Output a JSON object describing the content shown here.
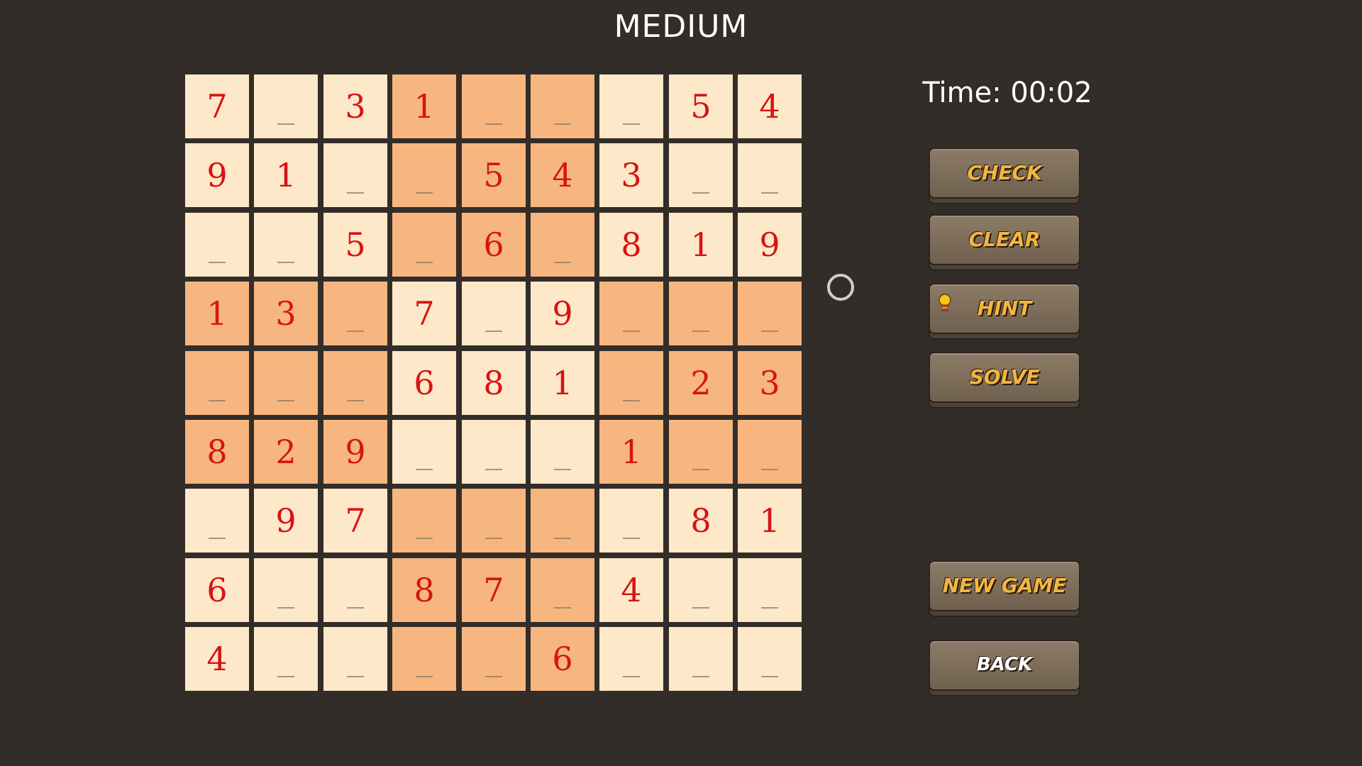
{
  "header": {
    "difficulty": "MEDIUM"
  },
  "timer": {
    "text": "Time: 00:02"
  },
  "board": {
    "rows": [
      [
        "7",
        "",
        "3",
        "1",
        "",
        "",
        "",
        "5",
        "4"
      ],
      [
        "9",
        "1",
        "",
        "",
        "5",
        "4",
        "3",
        "",
        ""
      ],
      [
        "",
        "",
        "5",
        "",
        "6",
        "",
        "8",
        "1",
        "9"
      ],
      [
        "1",
        "3",
        "",
        "7",
        "",
        "9",
        "",
        "",
        ""
      ],
      [
        "",
        "",
        "",
        "6",
        "8",
        "1",
        "",
        "2",
        "3"
      ],
      [
        "8",
        "2",
        "9",
        "",
        "",
        "",
        "1",
        "",
        ""
      ],
      [
        "",
        "9",
        "7",
        "",
        "",
        "",
        "",
        "8",
        "1"
      ],
      [
        "6",
        "",
        "",
        "8",
        "7",
        "",
        "4",
        "",
        ""
      ],
      [
        "4",
        "",
        "",
        "",
        "",
        "6",
        "",
        "",
        ""
      ]
    ]
  },
  "buttons": {
    "check": "CHECK",
    "clear": "CLEAR",
    "hint": "HINT",
    "solve": "SOLVE",
    "new_game": "NEW GAME",
    "back": "BACK"
  },
  "colors": {
    "background": "#332d29",
    "cell_light": "#fde8c9",
    "cell_dark": "#f7b680",
    "digit": "#d61414",
    "button_text": "#f2b640"
  },
  "icons": {
    "hint": "lightbulb-icon",
    "cursor": "circle-cursor-icon"
  }
}
